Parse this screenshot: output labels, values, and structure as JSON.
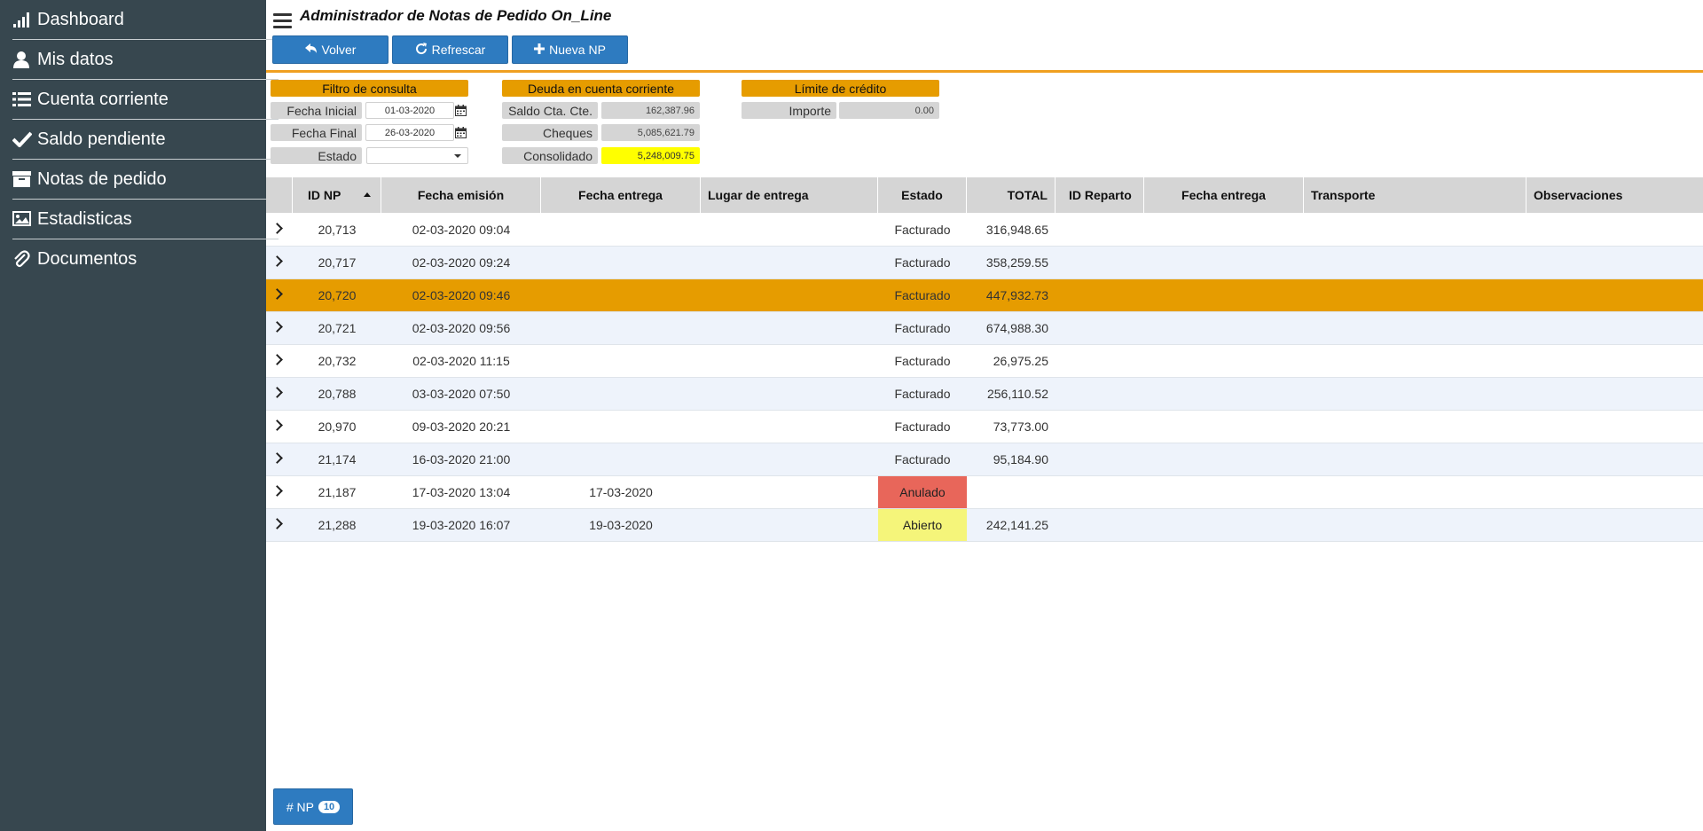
{
  "sidebar": {
    "items": [
      {
        "label": "Dashboard",
        "icon": "signal-bars-icon"
      },
      {
        "label": "Mis datos",
        "icon": "user-icon"
      },
      {
        "label": "Cuenta corriente",
        "icon": "list-icon"
      },
      {
        "label": "Saldo pendiente",
        "icon": "check-icon"
      },
      {
        "label": "Notas de pedido",
        "icon": "archive-icon"
      },
      {
        "label": "Estadisticas",
        "icon": "image-icon"
      },
      {
        "label": "Documentos",
        "icon": "paperclip-icon"
      }
    ]
  },
  "header": {
    "title": "Administrador de Notas de Pedido On_Line",
    "buttons": {
      "volver": "Volver",
      "refrescar": "Refrescar",
      "nueva": "Nueva NP"
    }
  },
  "filtro": {
    "title": "Filtro de consulta",
    "fecha_inicial_label": "Fecha Inicial",
    "fecha_inicial_value": "01-03-2020",
    "fecha_final_label": "Fecha Final",
    "fecha_final_value": "26-03-2020",
    "estado_label": "Estado",
    "estado_value": ""
  },
  "deuda": {
    "title": "Deuda en cuenta corriente",
    "saldo_label": "Saldo Cta. Cte.",
    "saldo_value": "162,387.96",
    "cheques_label": "Cheques",
    "cheques_value": "5,085,621.79",
    "consolidado_label": "Consolidado",
    "consolidado_value": "5,248,009.75"
  },
  "limite": {
    "title": "Límite de crédito",
    "importe_label": "Importe",
    "importe_value": "0.00"
  },
  "table": {
    "columns": {
      "id": "ID NP",
      "fecha_emision": "Fecha emisión",
      "fecha_entrega": "Fecha entrega",
      "lugar": "Lugar de entrega",
      "estado": "Estado",
      "total": "TOTAL",
      "reparto": "ID Reparto",
      "fecha_entrega2": "Fecha entrega",
      "transporte": "Transporte",
      "obs": "Observaciones"
    },
    "rows": [
      {
        "id": "20,713",
        "emision": "02-03-2020 09:04",
        "entrega": "",
        "estado": "Facturado",
        "total": "316,948.65"
      },
      {
        "id": "20,717",
        "emision": "02-03-2020 09:24",
        "entrega": "",
        "estado": "Facturado",
        "total": "358,259.55"
      },
      {
        "id": "20,720",
        "emision": "02-03-2020 09:46",
        "entrega": "",
        "estado": "Facturado",
        "total": "447,932.73"
      },
      {
        "id": "20,721",
        "emision": "02-03-2020 09:56",
        "entrega": "",
        "estado": "Facturado",
        "total": "674,988.30"
      },
      {
        "id": "20,732",
        "emision": "02-03-2020 11:15",
        "entrega": "",
        "estado": "Facturado",
        "total": "26,975.25"
      },
      {
        "id": "20,788",
        "emision": "03-03-2020 07:50",
        "entrega": "",
        "estado": "Facturado",
        "total": "256,110.52"
      },
      {
        "id": "20,970",
        "emision": "09-03-2020 20:21",
        "entrega": "",
        "estado": "Facturado",
        "total": "73,773.00"
      },
      {
        "id": "21,174",
        "emision": "16-03-2020 21:00",
        "entrega": "",
        "estado": "Facturado",
        "total": "95,184.90"
      },
      {
        "id": "21,187",
        "emision": "17-03-2020 13:04",
        "entrega": "17-03-2020",
        "estado": "Anulado",
        "total": ""
      },
      {
        "id": "21,288",
        "emision": "19-03-2020 16:07",
        "entrega": "19-03-2020",
        "estado": "Abierto",
        "total": "242,141.25"
      }
    ]
  },
  "footer": {
    "np_label": "# NP",
    "np_count": "10"
  },
  "colors": {
    "sidebar_bg": "#37474f",
    "accent_orange": "#e69c00",
    "button_blue": "#2e7bc0",
    "row_alt": "#eef3fb",
    "anulado": "#e8665a",
    "abierto": "#f5f57a",
    "consolidado": "#ffff00"
  }
}
